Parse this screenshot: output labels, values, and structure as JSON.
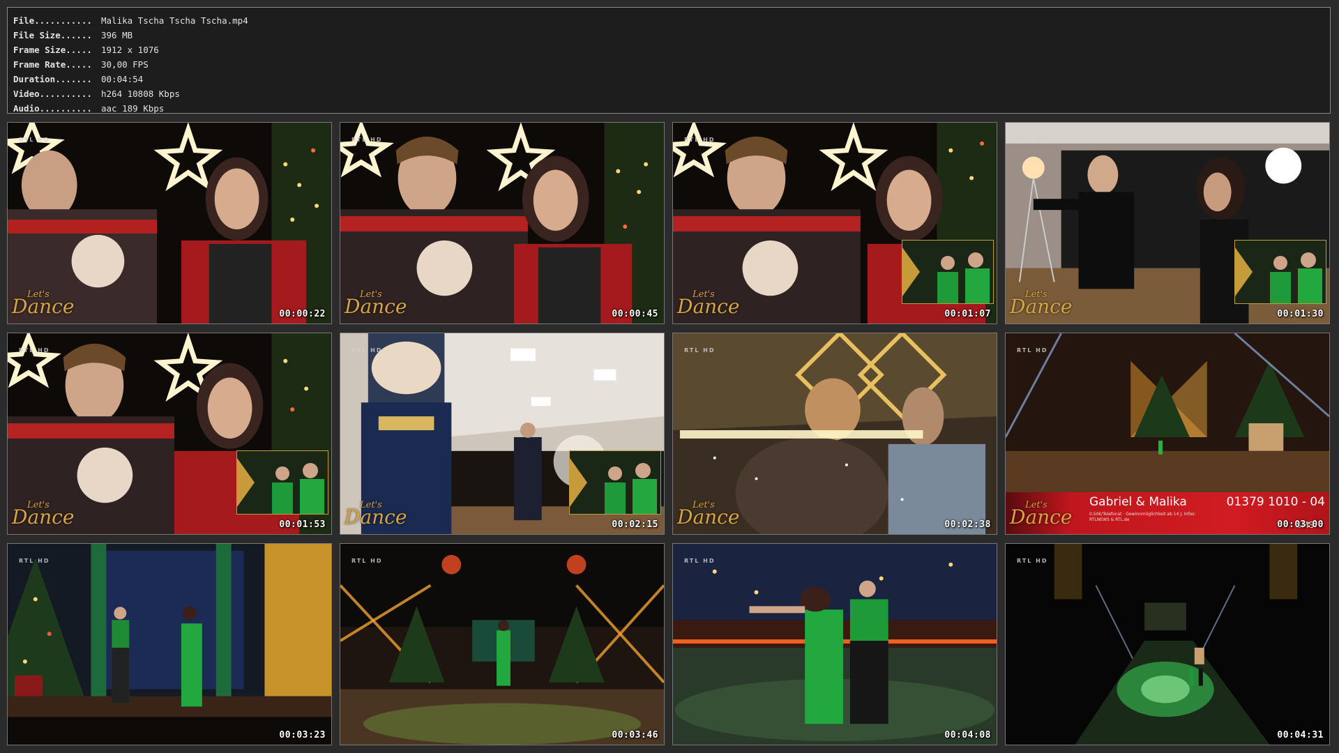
{
  "info": [
    {
      "key": "File...........",
      "value": "Malika Tscha Tscha Tscha.mp4"
    },
    {
      "key": "File Size......",
      "value": "396 MB"
    },
    {
      "key": "Frame Size.....",
      "value": "1912 x 1076"
    },
    {
      "key": "Frame Rate.....",
      "value": "30,00 FPS"
    },
    {
      "key": "Duration.......",
      "value": "00:04:54"
    },
    {
      "key": "Video..........",
      "value": "h264 10808 Kbps"
    },
    {
      "key": "Audio..........",
      "value": "aac 189 Kbps"
    }
  ],
  "logo": {
    "line1": "Let's",
    "line2": "Dance"
  },
  "channel": "RTL HD",
  "lower_third": {
    "name": "Gabriel & Malika",
    "phone": "01379 1010 - 04",
    "small": "0,50€/Telefonat · Gewinnmöglichkeit ab 14 J. Infos: RTLNEWS & RTL.de",
    "sms": "SMS:"
  },
  "thumbnails": [
    {
      "time": "00:00:22"
    },
    {
      "time": "00:00:45"
    },
    {
      "time": "00:01:07"
    },
    {
      "time": "00:01:30"
    },
    {
      "time": "00:01:53"
    },
    {
      "time": "00:02:15"
    },
    {
      "time": "00:02:38"
    },
    {
      "time": "00:03:00"
    },
    {
      "time": "00:03:23"
    },
    {
      "time": "00:03:46"
    },
    {
      "time": "00:04:08"
    },
    {
      "time": "00:04:31"
    }
  ]
}
